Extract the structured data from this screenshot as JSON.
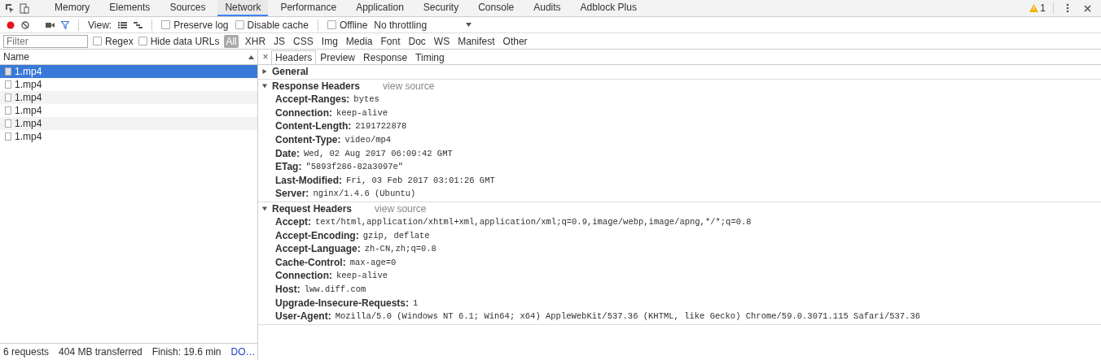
{
  "tabs": [
    {
      "label": "Memory",
      "selected": false
    },
    {
      "label": "Elements",
      "selected": false
    },
    {
      "label": "Sources",
      "selected": false
    },
    {
      "label": "Network",
      "selected": true
    },
    {
      "label": "Performance",
      "selected": false
    },
    {
      "label": "Application",
      "selected": false
    },
    {
      "label": "Security",
      "selected": false
    },
    {
      "label": "Console",
      "selected": false
    },
    {
      "label": "Audits",
      "selected": false
    },
    {
      "label": "Adblock Plus",
      "selected": false
    }
  ],
  "warning_count": "1",
  "toolbar": {
    "recording": true,
    "view_label": "View:",
    "checkboxes": [
      {
        "label": "Preserve log",
        "checked": false
      },
      {
        "label": "Disable cache",
        "checked": false
      },
      {
        "label": "Offline",
        "checked": false
      }
    ],
    "throttling": "No throttling"
  },
  "filter": {
    "placeholder": "Filter",
    "checkboxes": [
      {
        "label": "Regex",
        "checked": false
      },
      {
        "label": "Hide data URLs",
        "checked": false
      }
    ],
    "types": [
      {
        "label": "All",
        "selected": true
      },
      {
        "label": "XHR",
        "selected": false
      },
      {
        "label": "JS",
        "selected": false
      },
      {
        "label": "CSS",
        "selected": false
      },
      {
        "label": "Img",
        "selected": false
      },
      {
        "label": "Media",
        "selected": false
      },
      {
        "label": "Font",
        "selected": false
      },
      {
        "label": "Doc",
        "selected": false
      },
      {
        "label": "WS",
        "selected": false
      },
      {
        "label": "Manifest",
        "selected": false
      },
      {
        "label": "Other",
        "selected": false
      }
    ]
  },
  "requests": {
    "column": "Name",
    "rows": [
      {
        "name": "1.mp4",
        "selected": true
      },
      {
        "name": "1.mp4",
        "selected": false
      },
      {
        "name": "1.mp4",
        "selected": false
      },
      {
        "name": "1.mp4",
        "selected": false
      },
      {
        "name": "1.mp4",
        "selected": false
      },
      {
        "name": "1.mp4",
        "selected": false
      }
    ]
  },
  "detail": {
    "close": "×",
    "tabs": [
      {
        "label": "Headers",
        "selected": true
      },
      {
        "label": "Preview",
        "selected": false
      },
      {
        "label": "Response",
        "selected": false
      },
      {
        "label": "Timing",
        "selected": false
      }
    ],
    "sections": [
      {
        "title": "General",
        "expanded": false
      },
      {
        "title": "Response Headers",
        "expanded": true,
        "view_source": "view source",
        "headers": [
          {
            "name": "Accept-Ranges:",
            "value": "bytes"
          },
          {
            "name": "Connection:",
            "value": "keep-alive"
          },
          {
            "name": "Content-Length:",
            "value": "2191722878"
          },
          {
            "name": "Content-Type:",
            "value": "video/mp4"
          },
          {
            "name": "Date:",
            "value": "Wed, 02 Aug 2017 06:09:42 GMT"
          },
          {
            "name": "ETag:",
            "value": "\"5893f286-82a3097e\""
          },
          {
            "name": "Last-Modified:",
            "value": "Fri, 03 Feb 2017 03:01:26 GMT"
          },
          {
            "name": "Server:",
            "value": "nginx/1.4.6 (Ubuntu)"
          }
        ]
      },
      {
        "title": "Request Headers",
        "expanded": true,
        "view_source": "view source",
        "headers": [
          {
            "name": "Accept:",
            "value": "text/html,application/xhtml+xml,application/xml;q=0.9,image/webp,image/apng,*/*;q=0.8"
          },
          {
            "name": "Accept-Encoding:",
            "value": "gzip, deflate"
          },
          {
            "name": "Accept-Language:",
            "value": "zh-CN,zh;q=0.8"
          },
          {
            "name": "Cache-Control:",
            "value": "max-age=0"
          },
          {
            "name": "Connection:",
            "value": "keep-alive"
          },
          {
            "name": "Host:",
            "value": "lww.diff.com"
          },
          {
            "name": "Upgrade-Insecure-Requests:",
            "value": "1"
          },
          {
            "name": "User-Agent:",
            "value": "Mozilla/5.0 (Windows NT 6.1; Win64; x64) AppleWebKit/537.36 (KHTML, like Gecko) Chrome/59.0.3071.115 Safari/537.36"
          }
        ]
      }
    ]
  },
  "status": [
    {
      "text": "6 requests",
      "kind": "text"
    },
    {
      "text": "404 MB transferred",
      "kind": "text"
    },
    {
      "text": "Finish: 19.6 min",
      "kind": "text"
    },
    {
      "text": "DO…",
      "kind": "link"
    }
  ]
}
